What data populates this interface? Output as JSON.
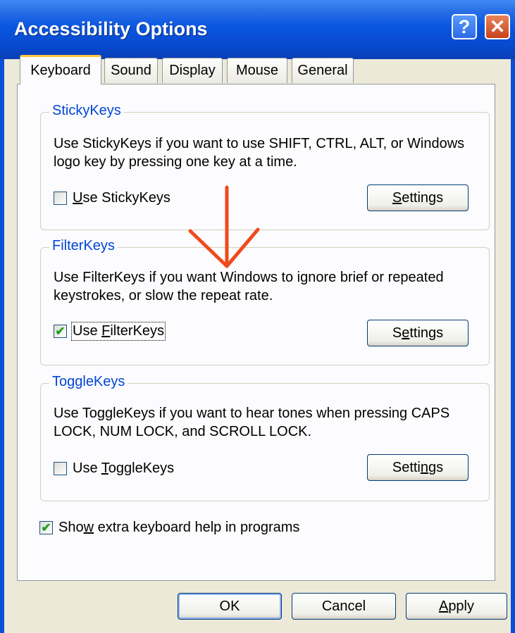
{
  "window": {
    "title": "Accessibility Options",
    "help_symbol": "?",
    "close_symbol": "✕"
  },
  "tabs": [
    {
      "label": "Keyboard",
      "active": true
    },
    {
      "label": "Sound",
      "active": false
    },
    {
      "label": "Display",
      "active": false
    },
    {
      "label": "Mouse",
      "active": false
    },
    {
      "label": "General",
      "active": false
    }
  ],
  "groups": {
    "sticky": {
      "title": "StickyKeys",
      "description": "Use StickyKeys if you want to use SHIFT, CTRL, ALT, or Windows logo key by pressing one key at a time.",
      "checkbox_label": {
        "pre": "",
        "key": "U",
        "post": "se StickyKeys"
      },
      "checked": false,
      "settings": {
        "pre": "",
        "key": "S",
        "post": "ettings"
      }
    },
    "filter": {
      "title": "FilterKeys",
      "description": "Use FilterKeys if you want Windows to ignore brief or repeated keystrokes, or slow the repeat rate.",
      "checkbox_label": {
        "pre": "Use ",
        "key": "F",
        "post": "ilterKeys"
      },
      "checked": true,
      "settings": {
        "pre": "S",
        "key": "e",
        "post": "ttings"
      }
    },
    "toggle": {
      "title": "ToggleKeys",
      "description": "Use ToggleKeys if you want to hear tones when pressing CAPS LOCK, NUM LOCK, and SCROLL LOCK.",
      "checkbox_label": {
        "pre": "Use ",
        "key": "T",
        "post": "oggleKeys"
      },
      "checked": false,
      "settings": {
        "pre": "Setti",
        "key": "n",
        "post": "gs"
      }
    }
  },
  "extra_help": {
    "label": {
      "pre": "Sho",
      "key": "w",
      "post": " extra keyboard help in programs"
    },
    "checked": true
  },
  "buttons": {
    "ok": "OK",
    "cancel": "Cancel",
    "apply": {
      "pre": "",
      "key": "A",
      "post": "pply"
    }
  },
  "check_glyph": "✔",
  "colors": {
    "title_bar": "#0a56e0",
    "group_title": "#0046d5",
    "active_tab_accent": "#ffc83c",
    "annotation_arrow": "#f04a1c"
  }
}
